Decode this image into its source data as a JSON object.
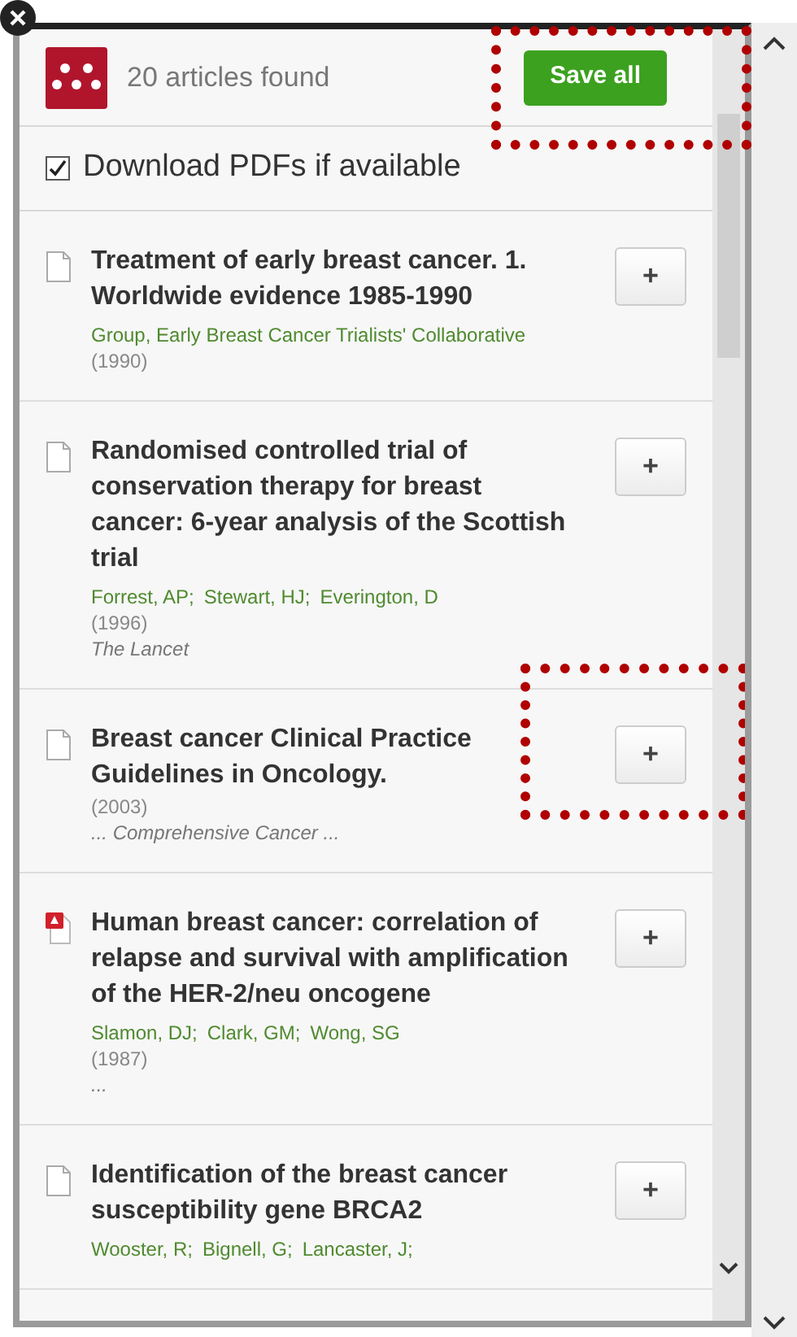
{
  "header": {
    "count_text": "20 articles found",
    "save_button": "Save all"
  },
  "download_pdfs": {
    "label": "Download PDFs if available",
    "checked": true
  },
  "articles": [
    {
      "kind": "document",
      "title": "Treatment of early breast cancer. 1. Worldwide evidence 1985-1990",
      "authors": [
        "Group, Early Breast Cancer Trialists' Collaborative"
      ],
      "year": "(1990)",
      "add": "+"
    },
    {
      "kind": "document",
      "title": "Randomised controlled trial of conservation therapy for breast cancer: 6-year analysis of the Scottish trial",
      "authors": [
        "Forrest, AP;",
        "Stewart, HJ;",
        "Everington, D"
      ],
      "year": "(1996)",
      "journal": "The Lancet",
      "add": "+",
      "highlighted": false
    },
    {
      "kind": "document",
      "title": "Breast cancer Clinical Practice Guidelines in Oncology.",
      "year": "(2003)",
      "journal": "... Comprehensive Cancer ...",
      "add": "+",
      "highlighted": true
    },
    {
      "kind": "pdf",
      "title": "Human breast cancer: correlation of relapse and survival with amplification of the HER-2/neu oncogene",
      "authors": [
        "Slamon, DJ;",
        "Clark, GM;",
        "Wong, SG"
      ],
      "year": "(1987)",
      "journal": "...",
      "add": "+"
    },
    {
      "kind": "document",
      "title": "Identification of the breast cancer susceptibility gene BRCA2",
      "authors": [
        "Wooster, R;",
        "Bignell, G;",
        "Lancaster, J;"
      ],
      "add": "+"
    }
  ]
}
